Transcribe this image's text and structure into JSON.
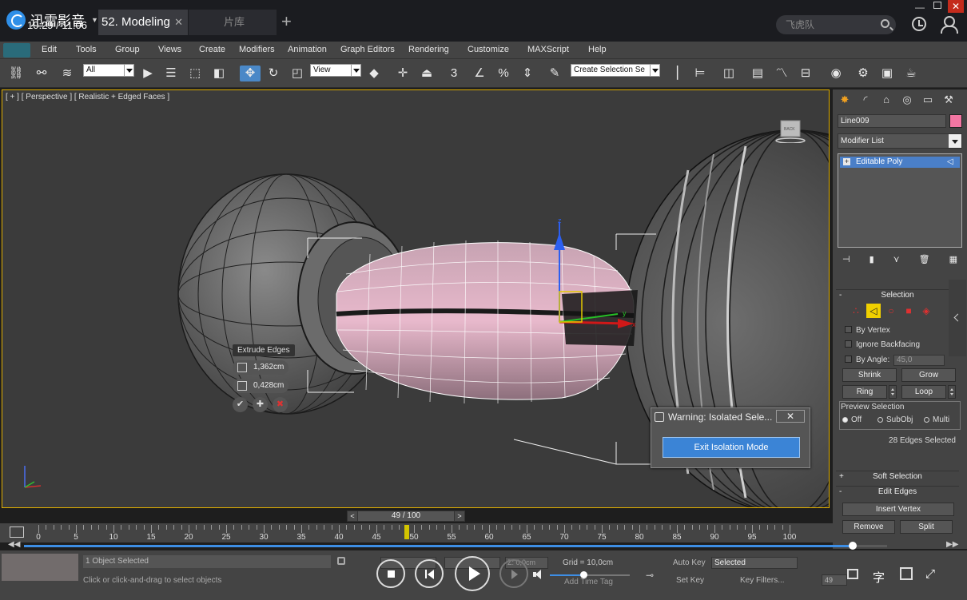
{
  "player": {
    "logo_text": "迅雷影音",
    "tabs": [
      {
        "label": "52. Modeling",
        "active": true
      },
      {
        "label": "片库",
        "active": false
      }
    ],
    "search_placeholder": "飞虎队",
    "time_label": "10:29 / 11:06",
    "progress": 0.96,
    "volume": 0.42
  },
  "menubar": {
    "items": [
      "Edit",
      "Tools",
      "Group",
      "Views",
      "Create",
      "Modifiers",
      "Animation",
      "Graph Editors",
      "Rendering",
      "Customize",
      "MAXScript",
      "Help"
    ]
  },
  "toolbar": {
    "selection_filter": "All",
    "ref_coord": "View",
    "named_selection": "Create Selection Se",
    "snap_label": "3",
    "icons": [
      "link-icon",
      "unlink-icon",
      "bind-space-warp-icon",
      "select-object-icon",
      "select-by-name-icon",
      "rect-region-icon",
      "window-crossing-icon",
      "move-icon",
      "rotate-icon",
      "scale-icon",
      "pivot-icon",
      "manipulate-icon",
      "keyboard-shortcut-icon",
      "snap-icon",
      "angle-snap-icon",
      "percent-snap-icon",
      "spinner-snap-icon",
      "edit-named-sel-icon",
      "mirror-icon",
      "align-icon",
      "layer-icon",
      "scene-explorer-icon",
      "curve-editor-icon",
      "schematic-icon",
      "material-editor-icon",
      "render-setup-icon",
      "render-frame-icon",
      "render-icon"
    ]
  },
  "viewport": {
    "label": "[ + ] [ Perspective ] [ Realistic + Edged Faces ]",
    "caddy": {
      "title": "Extrude Edges",
      "height": "1,362cm",
      "width": "0,428cm"
    },
    "viewcube_text": "BACK",
    "axes": {
      "y": "y",
      "z": "z",
      "x": "x"
    }
  },
  "dialog": {
    "title": "Warning: Isolated Sele...",
    "close_label": "✕",
    "button_label": "Exit Isolation Mode"
  },
  "command_panel": {
    "object_name": "Line009",
    "object_color": "#f276a2",
    "modifier_list_label": "Modifier List",
    "stack_item": "Editable Poly",
    "selection": {
      "title": "Selection",
      "by_vertex": "By Vertex",
      "ignore_backfacing": "Ignore Backfacing",
      "by_angle": "By Angle:",
      "angle_value": "45,0",
      "shrink": "Shrink",
      "grow": "Grow",
      "ring": "Ring",
      "loop": "Loop",
      "preview_label": "Preview Selection",
      "preview_options": [
        "Off",
        "SubObj",
        "Multi"
      ],
      "count_text": "28 Edges Selected"
    },
    "soft_selection": "Soft Selection",
    "edit_edges": {
      "title": "Edit Edges",
      "insert_vertex": "Insert Vertex",
      "remove": "Remove",
      "split": "Split"
    }
  },
  "timeline": {
    "slider_text": "49 / 100",
    "current_frame": 49,
    "ticks": [
      0,
      5,
      10,
      15,
      20,
      25,
      30,
      35,
      40,
      45,
      50,
      55,
      60,
      65,
      70,
      75,
      80,
      85,
      90,
      95,
      100
    ]
  },
  "statusbar": {
    "objects": "1 Object Selected",
    "prompt": "Click or click-and-drag to select objects",
    "coord_z": "Z: 0,0cm",
    "grid": "Grid = 10,0cm",
    "add_time_tag": "Add Time Tag",
    "auto_key": "Auto Key",
    "set_key": "Set Key",
    "key_mode": "Selected",
    "key_filters": "Key Filters...",
    "frame": "49"
  }
}
